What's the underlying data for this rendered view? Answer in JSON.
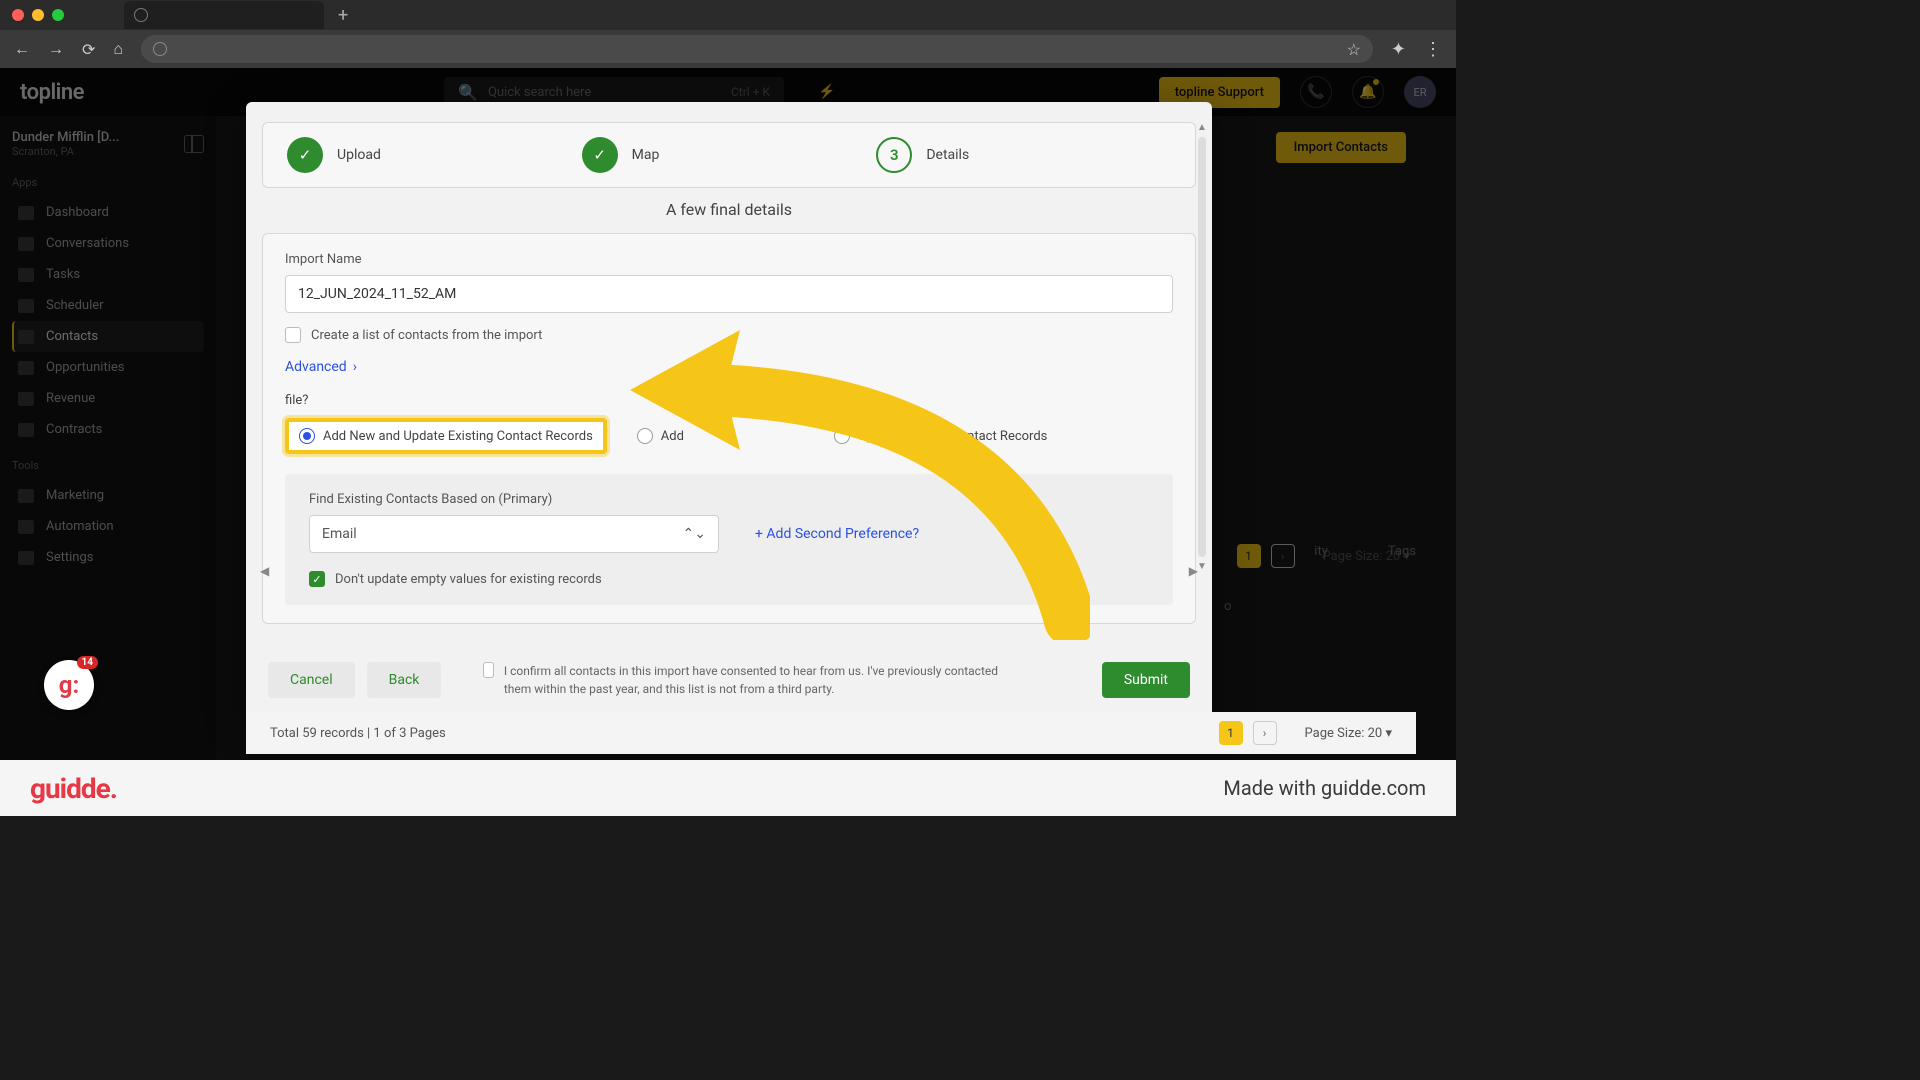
{
  "browser": {
    "plus": "+"
  },
  "header": {
    "logo": "topline",
    "search_placeholder": "Quick search here",
    "shortcut": "Ctrl + K",
    "support": "topline Support",
    "avatar": "ER"
  },
  "account": {
    "name": "Dunder Mifflin [D...",
    "loc": "Scranton, PA"
  },
  "sidebar": {
    "apps_label": "Apps",
    "tools_label": "Tools",
    "items": [
      {
        "label": "Dashboard"
      },
      {
        "label": "Conversations"
      },
      {
        "label": "Tasks"
      },
      {
        "label": "Scheduler"
      },
      {
        "label": "Contacts"
      },
      {
        "label": "Opportunities"
      },
      {
        "label": "Revenue"
      },
      {
        "label": "Contracts"
      }
    ],
    "tools": [
      {
        "label": "Marketing"
      },
      {
        "label": "Automation",
        "badge": "14"
      },
      {
        "label": "Settings"
      }
    ]
  },
  "main": {
    "import_btn": "Import Contacts"
  },
  "modal": {
    "steps": [
      {
        "label": "Upload",
        "state": "done"
      },
      {
        "label": "Map",
        "state": "done"
      },
      {
        "num": "3",
        "label": "Details",
        "state": "current"
      }
    ],
    "title": "A few final details",
    "import_name_label": "Import Name",
    "import_name_value": "12_JUN_2024_11_52_AM",
    "create_list": "Create a list of contacts from the import",
    "advanced": "Advanced",
    "question_suffix": " file?",
    "radios": {
      "opt1": "Add New and Update Existing Contact Records",
      "opt2": "Add",
      "opt3": "Update Existing Contact Records"
    },
    "primary_label": "Find Existing Contacts Based on (Primary)",
    "primary_value": "Email",
    "add_second": "+ Add Second Preference?",
    "dont_update": "Don't update empty values for existing records",
    "cancel": "Cancel",
    "back": "Back",
    "consent": "I confirm all contacts in this import have consented to hear from us. I've previously contacted them within the past year, and this list is not from a third party.",
    "submit": "Submit"
  },
  "records": {
    "total": "Total 59 records | 1 of 3 Pages",
    "page": "1",
    "page_size": "Page Size: 20"
  },
  "table_stub": {
    "pager_page": "1",
    "pager_size": "Page Size: 20",
    "col1": "ity",
    "col2": "Tags",
    "cell": "o"
  },
  "footer": {
    "logo": "guidde.",
    "made": "Made with guidde.com"
  },
  "float_badge": "14"
}
